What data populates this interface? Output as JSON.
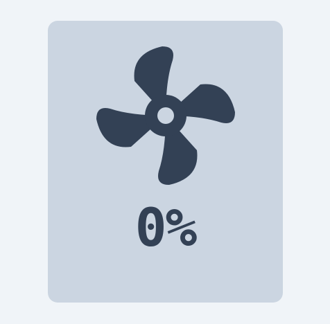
{
  "fan": {
    "speed_text": "0%",
    "speed_percent": 0,
    "icon": "fan-icon"
  },
  "colors": {
    "background": "#f0f4f8",
    "card": "#cbd5e1",
    "foreground": "#334155"
  }
}
